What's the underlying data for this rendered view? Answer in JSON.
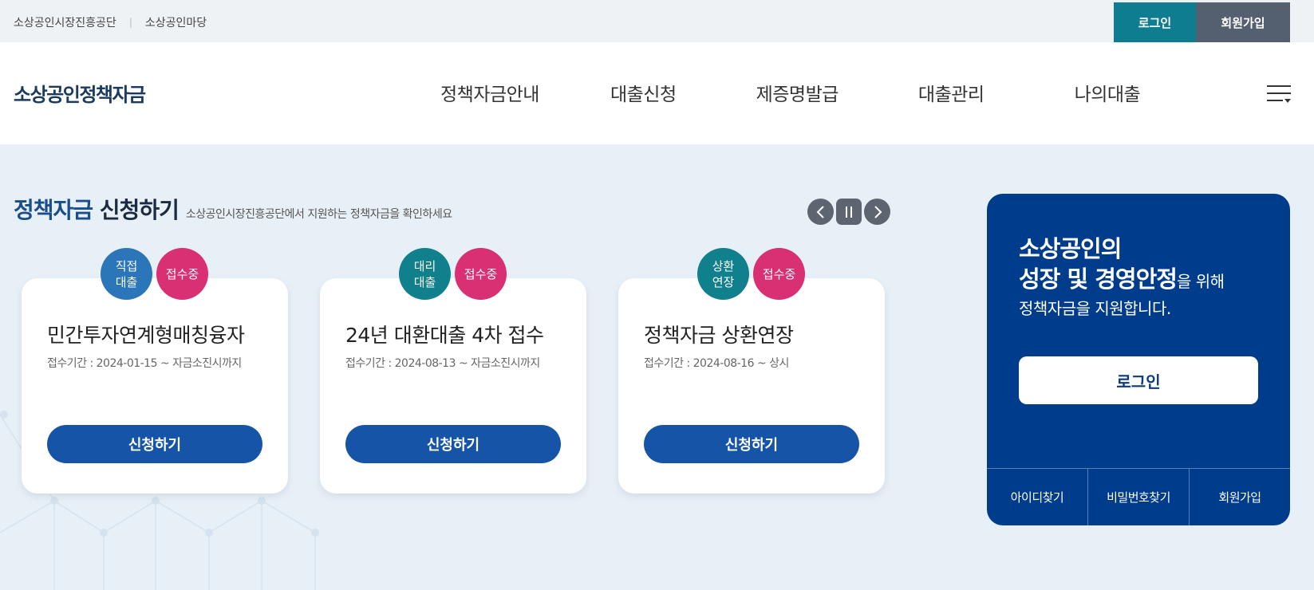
{
  "util": {
    "links": [
      "소상공인시장진흥공단",
      "소상공인마당"
    ],
    "separator": "|",
    "login": "로그인",
    "join": "회원가입"
  },
  "header": {
    "logo": "소상공인정책자금",
    "nav": [
      "정책자금안내",
      "대출신청",
      "제증명발급",
      "대출관리",
      "나의대출"
    ],
    "menu_icon": "hamburger-icon"
  },
  "section": {
    "title_accent": "정책자금",
    "title_rest": " 신청하기",
    "subtitle": "소상공인시장진흥공단에서 지원하는 정책자금을 확인하세요",
    "controls": {
      "prev": "chevron-left-icon",
      "pause": "pause-icon",
      "next": "chevron-right-icon"
    }
  },
  "cards": [
    {
      "type_line1": "직접",
      "type_line2": "대출",
      "status": "접수중",
      "title": "민간투자연계형매칭융자",
      "period": "접수기간 : 2024-01-15 ~ 자금소진시까지",
      "button": "신청하기"
    },
    {
      "type_line1": "대리",
      "type_line2": "대출",
      "status": "접수중",
      "title": "24년 대환대출 4차 접수",
      "period": "접수기간 : 2024-08-13 ~ 자금소진시까지",
      "button": "신청하기"
    },
    {
      "type_line1": "상환",
      "type_line2": "연장",
      "status": "접수중",
      "title": "정책자금 상환연장",
      "period": "접수기간 : 2024-08-16 ~ 상시",
      "button": "신청하기"
    }
  ],
  "login_panel": {
    "line1": "소상공인의",
    "line2": "성장 및 경영안정",
    "line2_suffix": "을 위해",
    "line3": "정책자금을 지원합니다.",
    "login_button": "로그인",
    "links": [
      "아이디찾기",
      "비밀번호찾기",
      "회원가입"
    ]
  },
  "colors": {
    "brand_navy": "#003c8c",
    "button_blue": "#1654a8",
    "teal": "#0e7d8f",
    "status_pink": "#d92f73"
  }
}
